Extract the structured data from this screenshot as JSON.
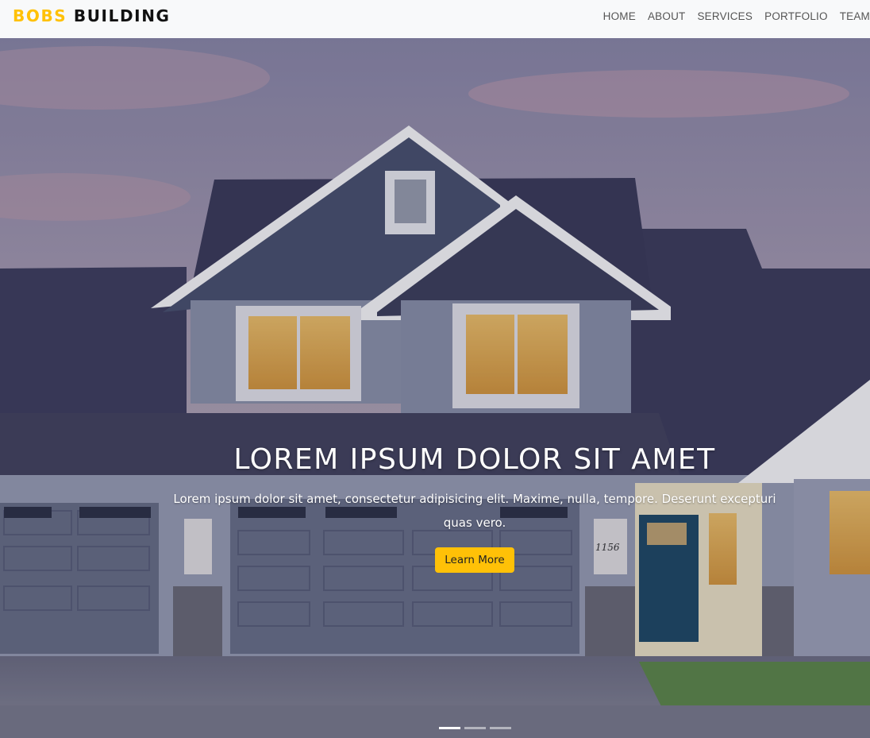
{
  "brand": {
    "part1": "BOBS",
    "part2": "BUILDING"
  },
  "nav": {
    "items": [
      {
        "label": "HOME"
      },
      {
        "label": "ABOUT"
      },
      {
        "label": "SERVICES"
      },
      {
        "label": "PORTFOLIO"
      },
      {
        "label": "TEAM"
      }
    ]
  },
  "hero": {
    "title": "LOREM IPSUM DOLOR SIT AMET",
    "text": "Lorem ipsum dolor sit amet, consectetur adipisicing elit. Maxime, nulla, tempore. Deserunt excepturi quas vero.",
    "button_label": "Learn More",
    "house_number": "1156",
    "slides": {
      "count": 3,
      "active": 1
    }
  },
  "colors": {
    "accent": "#ffc107",
    "navbar_bg": "#f8f9fa",
    "brand_dark": "#111111"
  }
}
